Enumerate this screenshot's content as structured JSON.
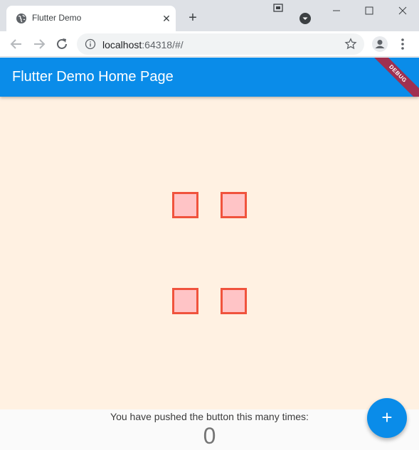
{
  "browser": {
    "tab_title": "Flutter Demo",
    "tab_close": "✕",
    "new_tab": "+",
    "url_host": "localhost",
    "url_rest": ":64318/#/"
  },
  "app": {
    "appbar_title": "Flutter Demo Home Page",
    "debug_banner": "DEBUG",
    "counter_label": "You have pushed the button this many times:",
    "counter_value": "0",
    "fab_label": "+"
  },
  "colors": {
    "appbar": "#0a8ce9",
    "canvas_background": "#fff1e2",
    "square_fill": "#ffc4c6",
    "square_border": "#f0533d"
  },
  "icons": {
    "tab_favicon": "globe-icon",
    "back": "arrow-left-icon",
    "forward": "arrow-right-icon",
    "reload": "reload-icon",
    "info": "info-icon",
    "bookmark": "star-icon",
    "profile": "profile-icon",
    "menu": "kebab-menu-icon",
    "fab": "plus-icon"
  }
}
